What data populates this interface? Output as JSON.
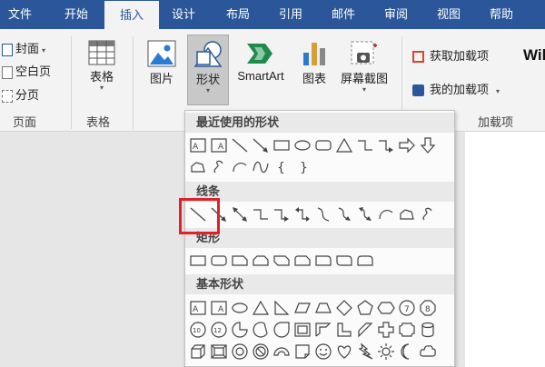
{
  "tabs": [
    "文件",
    "开始",
    "插入",
    "设计",
    "布局",
    "引用",
    "邮件",
    "审阅",
    "视图",
    "帮助"
  ],
  "ribbon": {
    "pages_items": [
      "封面",
      "空白页",
      "分页"
    ],
    "pages_group": "页面",
    "table_label": "表格",
    "table_group": "表格",
    "picture_label": "图片",
    "shapes_label": "形状",
    "smartart_label": "SmartArt",
    "chart_label": "图表",
    "screenshot_label": "屏幕截图",
    "get_addins": "获取加载项",
    "my_addins": "我的加载项",
    "addins_group": "加载项",
    "wiki_label": "Wik"
  },
  "dropdown": {
    "recent_title": "最近使用的形状",
    "lines_title": "线条",
    "rect_title": "矩形",
    "basic_title": "基本形状"
  },
  "colors": {
    "accent": "#2b579a",
    "highlight": "#e0202a"
  }
}
